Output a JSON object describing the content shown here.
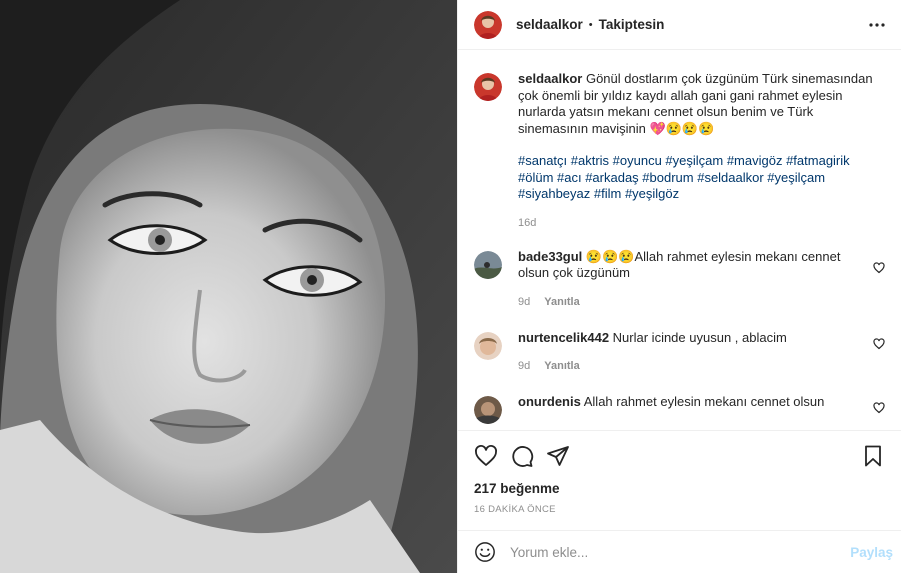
{
  "post": {
    "author": "seldaalkor",
    "follow_status": "Takiptesin",
    "separator": "•",
    "caption": "Gönül dostlarım çok üzgünüm Türk sinemasından çok önemli bir yıldız kaydı allah gani gani rahmet eylesin nurlarda yatsın mekanı cennet olsun benim ve Türk sinemasının mavişinin 💖😢😢😢",
    "hashtags": "#sanatçı #aktris #oyuncu #yeşilçam #mavigöz #fatmagirik #ölüm #acı #arkadaş #bodrum #seldaalkor #yeşilçam #siyahbeyaz #film #yeşilgöz",
    "caption_age": "16d",
    "likes": "217 beğenme",
    "posted_ago": "16 DAKİKA ÖNCE"
  },
  "comments": [
    {
      "user": "bade33gul",
      "text": "😢😢😢Allah rahmet eylesin mekanı cennet olsun çok üzgünüm",
      "age": "9d",
      "reply": "Yanıtla",
      "avatar_color": "#7a8a96"
    },
    {
      "user": "nurtencelik442",
      "text": "Nurlar icinde uyusun , ablacim",
      "age": "9d",
      "reply": "Yanıtla",
      "avatar_color": "#e0b89a"
    },
    {
      "user": "onurdenis",
      "text": "Allah rahmet eylesin mekanı cennet olsun",
      "age": "",
      "reply": "",
      "avatar_color": "#6e5a48"
    }
  ],
  "add_comment": {
    "placeholder": "Yorum ekle...",
    "post_label": "Paylaş"
  },
  "icons": {
    "more": "more-horizontal-icon",
    "like": "heart-icon",
    "comment": "comment-icon",
    "share": "paper-plane-icon",
    "save": "bookmark-icon",
    "emoji": "emoji-smile-icon"
  },
  "colors": {
    "hashtag": "#00376b",
    "muted": "#8e8e8e",
    "post_button_disabled": "#b2dffc",
    "text": "#262626"
  }
}
